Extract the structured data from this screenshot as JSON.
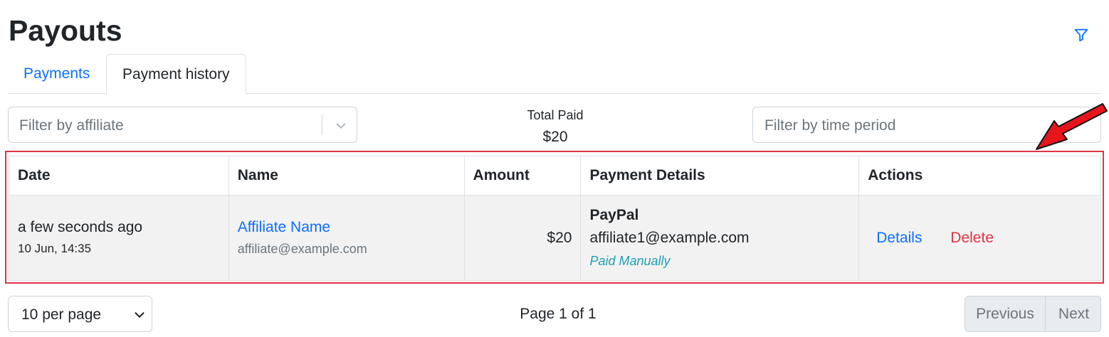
{
  "page": {
    "title": "Payouts"
  },
  "icons": {
    "filter": "filter-icon",
    "chevron": "chevron-down-icon",
    "annotation": "red-arrow-icon"
  },
  "colors": {
    "link": "#0d6efd",
    "danger": "#dc3545",
    "info": "#1e9fb2",
    "annotation": "#e8141b"
  },
  "tabs": [
    {
      "label": "Payments",
      "active": false
    },
    {
      "label": "Payment history",
      "active": true
    }
  ],
  "filters": {
    "affiliate_placeholder": "Filter by affiliate",
    "period_placeholder": "Filter by time period"
  },
  "summary": {
    "label": "Total Paid",
    "value": "$20"
  },
  "table": {
    "columns": [
      "Date",
      "Name",
      "Amount",
      "Payment Details",
      "Actions"
    ],
    "rows": [
      {
        "date_relative": "a few seconds ago",
        "date_absolute": "10 Jun, 14:35",
        "affiliate_name": "Affiliate Name",
        "affiliate_email": "affiliate@example.com",
        "amount": "$20",
        "payment_method": "PayPal",
        "payment_email": "affiliate1@example.com",
        "payment_note": "Paid Manually",
        "actions": [
          "Details",
          "Delete"
        ]
      }
    ]
  },
  "pagination": {
    "per_page": "10 per page",
    "page_info": "Page 1 of 1",
    "previous": "Previous",
    "next": "Next"
  }
}
